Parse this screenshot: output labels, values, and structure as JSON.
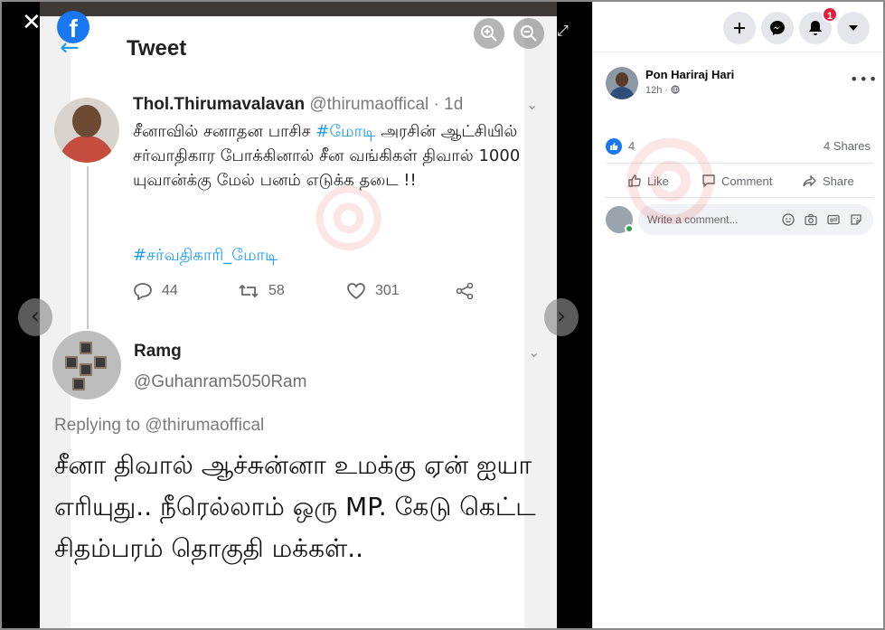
{
  "viewer": {
    "tweet_heading": "Tweet",
    "tweet": {
      "author_name": "Thol.Thirumavalavan",
      "author_handle": "@thirumaoffical · 1d",
      "body_before": "சீனாவில் சனாதன பாசிச ",
      "hashtag1": "#மோடி",
      "body_after": " அரசின் ஆட்சியில் சர்வாதிகார போக்கினால் சீன வங்கிகள் திவால்  1000 யுவான்க்கு மேல் பனம் எடுக்க தடை !!",
      "hashtag2": "#சர்வதிகாரி_மோடி",
      "replies": "44",
      "retweets": "58",
      "likes": "301"
    },
    "reply": {
      "author_name": "Ramg",
      "author_handle": "@Guhanram5050Ram",
      "replying_to": "Replying to @thirumaoffical",
      "body": "சீனா திவால் ஆச்சுன்னா உமக்கு ஏன் ஐயா எரியுது.. நீரெல்லாம் ஒரு MP. கேடு கெட்ட சிதம்பரம் தொகுதி மக்கள்.."
    },
    "close_label": "✕",
    "fb_letter": "f",
    "prev_label": "‹",
    "next_label": "›"
  },
  "panel": {
    "notification_count": "1",
    "post_author": "Pon Hariraj Hari",
    "post_time": "12h ·",
    "more_label": "•••",
    "like_count": "4",
    "shares_label": "4 Shares",
    "actions": {
      "like": "Like",
      "comment": "Comment",
      "share": "Share"
    },
    "comment_placeholder": "Write a comment..."
  },
  "colors": {
    "facebook_blue": "#1877f2",
    "twitter_blue": "#1d9bf0",
    "notification_red": "#e41e3f",
    "online_green": "#31a24c"
  }
}
